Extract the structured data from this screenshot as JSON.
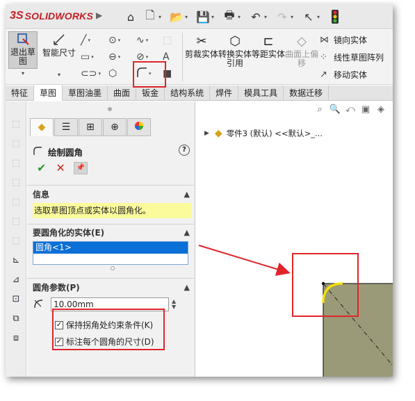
{
  "app": {
    "brand_mark": "3S",
    "brand_name": "SOLIDWORKS",
    "expand_arrow": "▶"
  },
  "toolbar": {
    "icons": [
      "home-icon",
      "new-document-icon",
      "open-folder-icon",
      "save-icon",
      "print-icon",
      "undo-icon",
      "redo-icon",
      "select-pointer-icon",
      "traffic-light-icon"
    ]
  },
  "ribbon": {
    "exit_sketch": "退出草图",
    "smart_dimension": "智能尺寸",
    "trim_entities": "剪裁实体",
    "convert_entities": "转换实体引用",
    "offset_entities": "等距实体",
    "surface_offset": "曲面上偏移",
    "mirror_entities": "镜向实体",
    "linear_pattern": "线性草图阵列",
    "move_entities": "移动实体",
    "mirror_shortcut": "",
    "linear_shortcut": "",
    "move_shortcut": ""
  },
  "tabs": [
    "特征",
    "草图",
    "草图油墨",
    "曲面",
    "钣金",
    "结构系统",
    "焊件",
    "模具工具",
    "数据迁移"
  ],
  "active_tab_index": 1,
  "property_manager": {
    "title": "绘制圆角",
    "help_label": "?",
    "info": {
      "header": "信息",
      "message": "选取草图顶点或实体以圆角化。"
    },
    "entities": {
      "header": "要圆角化的实体(E)",
      "selected_item": "圆角<1>"
    },
    "params": {
      "header": "圆角参数(P)",
      "radius_value": "10.00mm",
      "keep_constraint_label": "保持拐角处约束条件(K)",
      "keep_constraint_checked": true,
      "dimension_each_label": "标注每个圆角的尺寸(D)",
      "dimension_each_checked": true
    }
  },
  "graphics": {
    "tree_node": "零件3 (默认) <<默认>_...",
    "sketch_colors": {
      "fillet_arc": "#f5e000",
      "plate": "#9a9a78",
      "highlight": "#e0242a"
    }
  }
}
